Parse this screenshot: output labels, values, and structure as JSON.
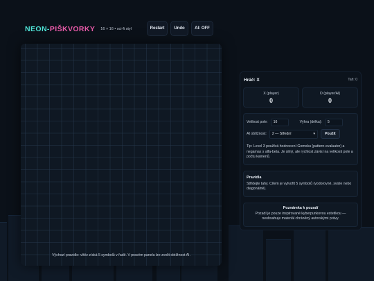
{
  "header": {
    "logo_part1": "NEON-",
    "logo_part2": "PIŠKVORKY",
    "subtitle": "16 × 16 • sci-fi styl",
    "restart_label": "Restart",
    "undo_label": "Undo",
    "ai_label": "AI: OFF"
  },
  "colors": {
    "accent_cyan": "#4fe3d6",
    "accent_pink": "#e85aa8",
    "background": "#0b1119"
  },
  "board": {
    "size": 16,
    "note": "Výchozí pravidlo: vítěz získá 5 symbolů v řadě. V pravém panelu lze zvolit obtížnost AI."
  },
  "status": {
    "player": "Hráč: X",
    "turn": "Tah: 0"
  },
  "scores": [
    {
      "label": "X (player)",
      "value": "0"
    },
    {
      "label": "O (player/AI)",
      "value": "0"
    }
  ],
  "settings": {
    "size_label": "Velikost pole:",
    "size_value": "16",
    "win_label": "Výhra (délka):",
    "win_value": "5",
    "ai_difficulty_label": "AI obtížnost:",
    "ai_difficulty_value": "2 — Střední",
    "apply_label": "Použít",
    "tip": "Tip: Level 3 používá hodnocení Gomoku (pattern-evaluator) a negamax s alfa-beta. Je silný, ale rychlost závisí na velikosti pole a počtu kamenů."
  },
  "rules": {
    "title": "Pravidla",
    "text": "Střídejte tahy. Cílem je vytvořit 5 symbolů (vodorovně, svisle nebo diagonálně)."
  },
  "background_note": {
    "title": "Poznámka k pozadí",
    "text": "Pozadí je pouze inspirované kyberpunkovou estetikou — neobsahuje materiál chráněný autorskými právy."
  }
}
